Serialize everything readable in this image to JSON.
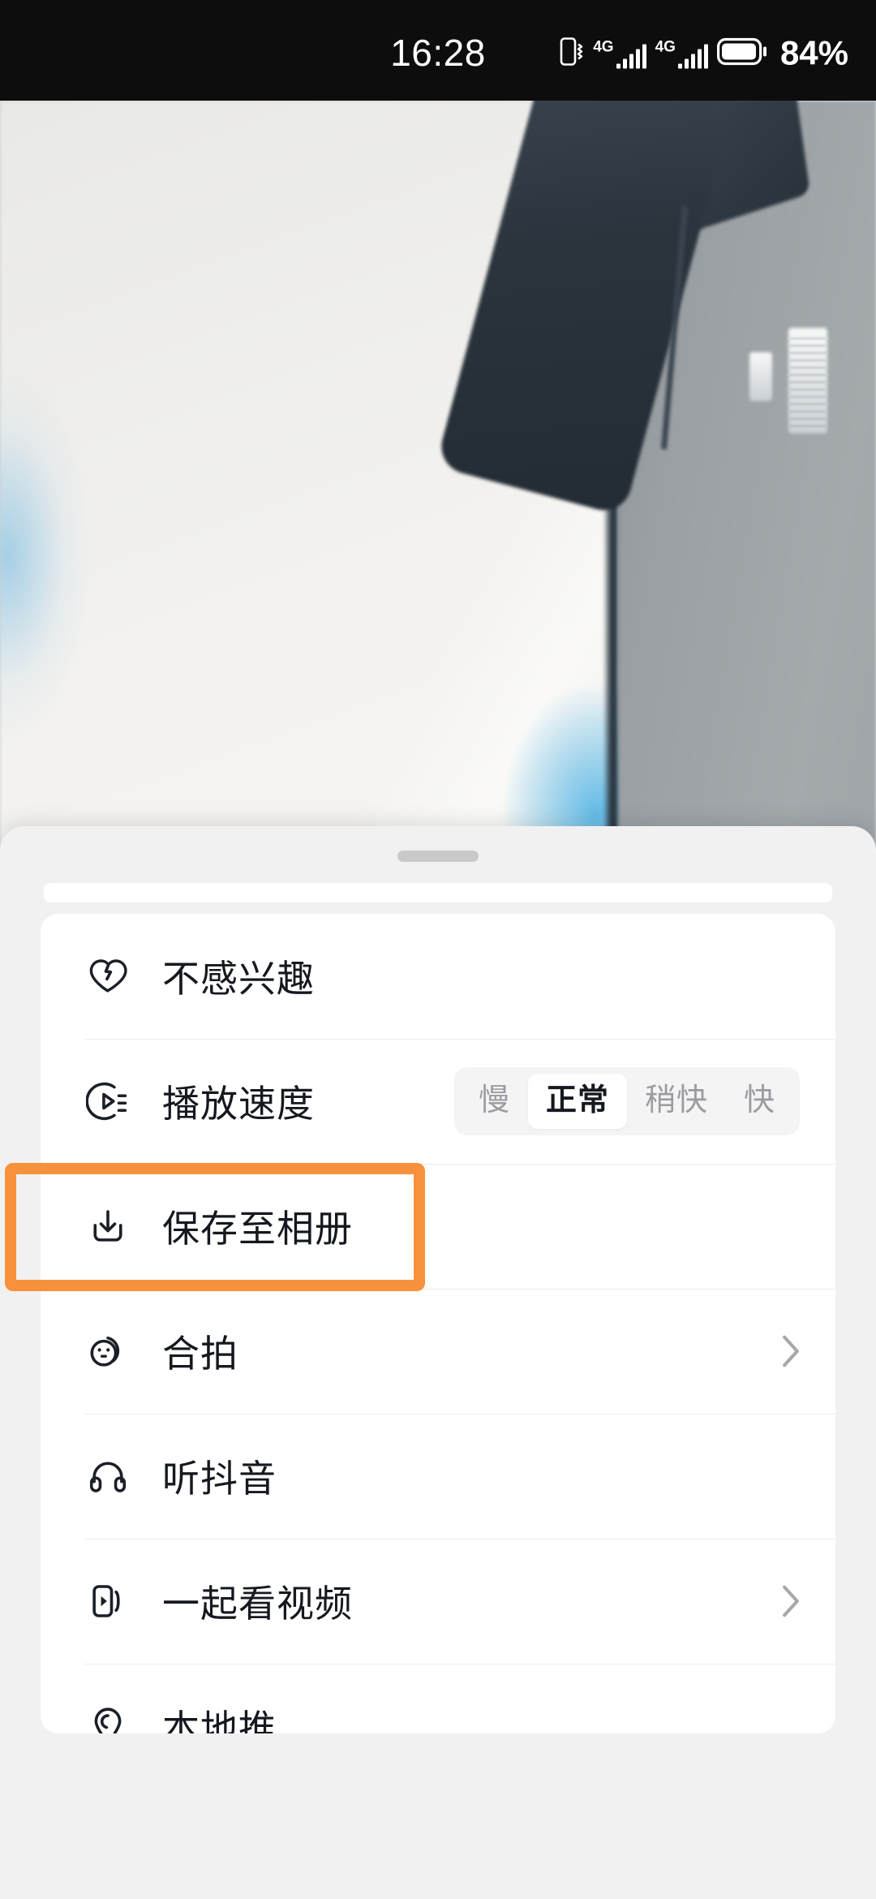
{
  "status_bar": {
    "time": "16:28",
    "battery_percent": "84%",
    "network_label_1": "4G",
    "network_label_2": "4G",
    "vibrate_icon": "vibrate-icon",
    "battery_icon": "battery-icon"
  },
  "video": {
    "description": "blurred indoor scene with dark speaker and gray wall"
  },
  "sheet": {
    "handle": "drag-handle"
  },
  "menu": {
    "items": [
      {
        "id": "not-interested",
        "label": "不感兴趣",
        "icon": "broken-heart-icon",
        "chevron": false,
        "control": null
      },
      {
        "id": "playback-speed",
        "label": "播放速度",
        "icon": "playback-speed-icon",
        "chevron": false,
        "control": "segmented"
      },
      {
        "id": "save-to-album",
        "label": "保存至相册",
        "icon": "download-icon",
        "chevron": false,
        "control": null,
        "highlighted": true
      },
      {
        "id": "duet",
        "label": "合拍",
        "icon": "duet-faces-icon",
        "chevron": true,
        "control": null
      },
      {
        "id": "listen-douyin",
        "label": "听抖音",
        "icon": "headphones-icon",
        "chevron": false,
        "control": null
      },
      {
        "id": "watch-together",
        "label": "一起看视频",
        "icon": "watch-together-icon",
        "chevron": true,
        "control": null
      },
      {
        "id": "local-promo",
        "label": "本地推",
        "icon": "location-pin-icon",
        "chevron": false,
        "control": null
      }
    ]
  },
  "speed_control": {
    "options": [
      "慢",
      "正常",
      "稍快",
      "快"
    ],
    "selected": "正常"
  },
  "annotation": {
    "highlight_color": "#F7913C",
    "target": "save-to-album"
  }
}
